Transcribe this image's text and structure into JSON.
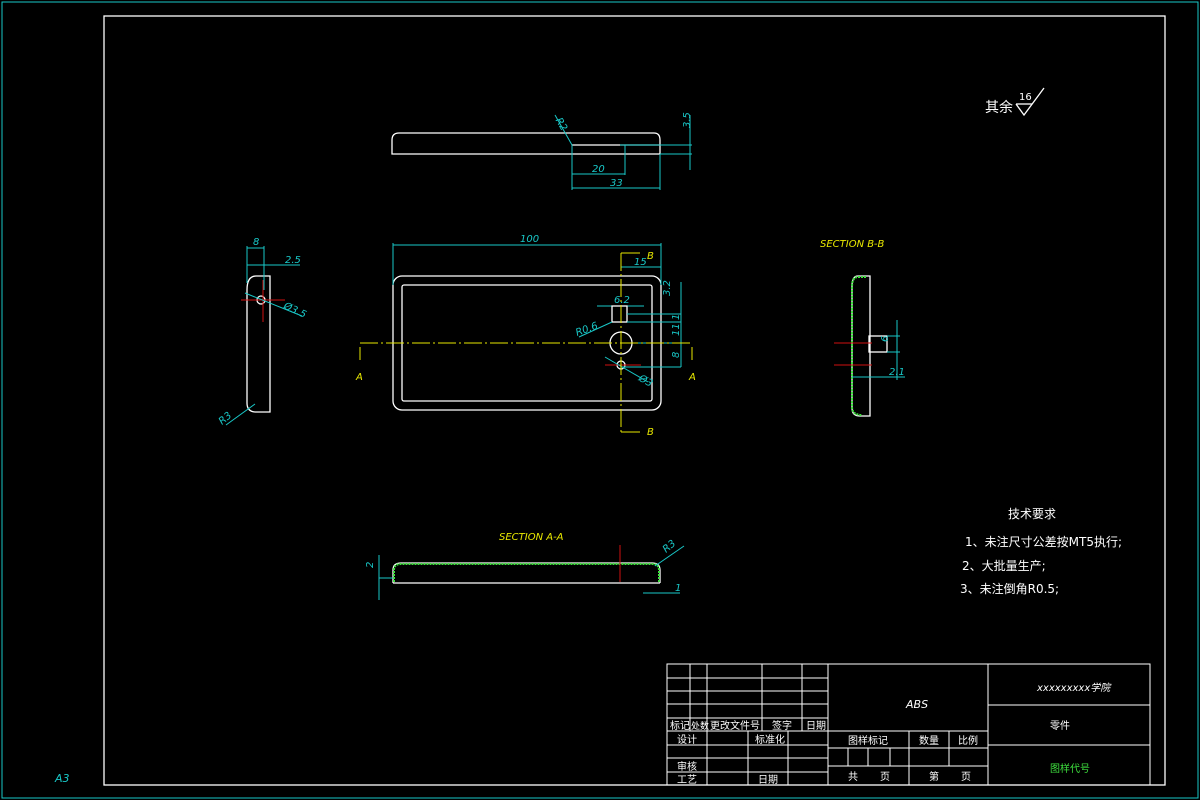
{
  "sheet": {
    "size_label": "A3",
    "colors": {
      "outline": "#ffffff",
      "dimension": "#19c8c8",
      "section_label": "#e8e800",
      "center_line": "#d01010",
      "hatch": "#3ee03e",
      "drawing_number": "#3ee03e"
    }
  },
  "roughness": {
    "prefix": "其余",
    "value": "16"
  },
  "top_view": {
    "dims": {
      "r": "R2",
      "len20": "20",
      "len33": "33",
      "h": "3.5"
    }
  },
  "front_view": {
    "dims": {
      "width": "100",
      "offset": "15",
      "slot": "6.2",
      "fillet": "R0.6",
      "d1": "3.2",
      "d2": "11.1",
      "d3": "8",
      "hole": "Ø3"
    },
    "section_marks": {
      "a": "A",
      "b": "B"
    }
  },
  "side_view": {
    "dims": {
      "w": "8",
      "off": "2.5",
      "hole": "Ø3.5",
      "r": "R3"
    }
  },
  "section_bb": {
    "title": "SECTION B-B",
    "dims": {
      "h": "6",
      "w": "2.1"
    }
  },
  "section_aa": {
    "title": "SECTION A-A",
    "dims": {
      "h": "2",
      "r": "R3",
      "t": "1"
    }
  },
  "tech_requirements": {
    "title": "技术要求",
    "items": [
      "1、未注尺寸公差按MT5执行;",
      "2、大批量生产;",
      "3、未注倒角R0.5;"
    ]
  },
  "title_block": {
    "material": "ABS",
    "school": "xxxxxxxxx学院",
    "part_name": "零件",
    "drawing_number": "图样代号",
    "rev_headers": [
      "标记",
      "处数",
      "更改文件号",
      "签字",
      "日期"
    ],
    "design": "设计",
    "standardization": "标准化",
    "review": "审核",
    "process": "工艺",
    "date": "日期",
    "drawing_mark": "图样标记",
    "quantity": "数量",
    "scale": "比例",
    "total": "共",
    "page": "页",
    "sheet_no": "第",
    "page2": "页"
  }
}
